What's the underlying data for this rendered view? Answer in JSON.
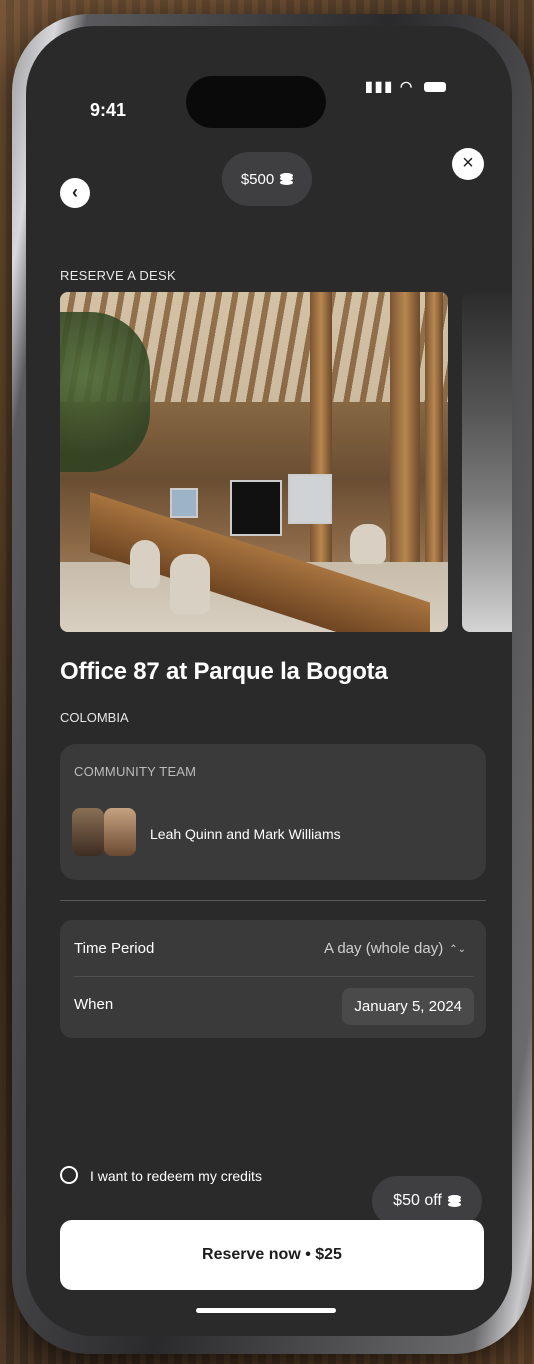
{
  "status_bar": {
    "time": "9:41"
  },
  "header": {
    "credits": "$500"
  },
  "page": {
    "section_label": "RESERVE A DESK",
    "office_title": "Office 87 at Parque la Bogota",
    "country": "COLOMBIA"
  },
  "community": {
    "label": "COMMUNITY TEAM",
    "names": "Leah Quinn and Mark Williams"
  },
  "details": {
    "time_period_label": "Time Period",
    "time_period_value": "A day (whole day)",
    "when_label": "When",
    "when_value": "January 5, 2024"
  },
  "redeem": {
    "text": "I want to redeem my credits",
    "discount": "$50 off",
    "checked": false
  },
  "cta": {
    "label": "Reserve now • $25"
  },
  "icons": {
    "back": "chevron-left-icon",
    "close": "close-icon",
    "coins": "coins-icon",
    "selector": "chevron-up-down-icon"
  }
}
